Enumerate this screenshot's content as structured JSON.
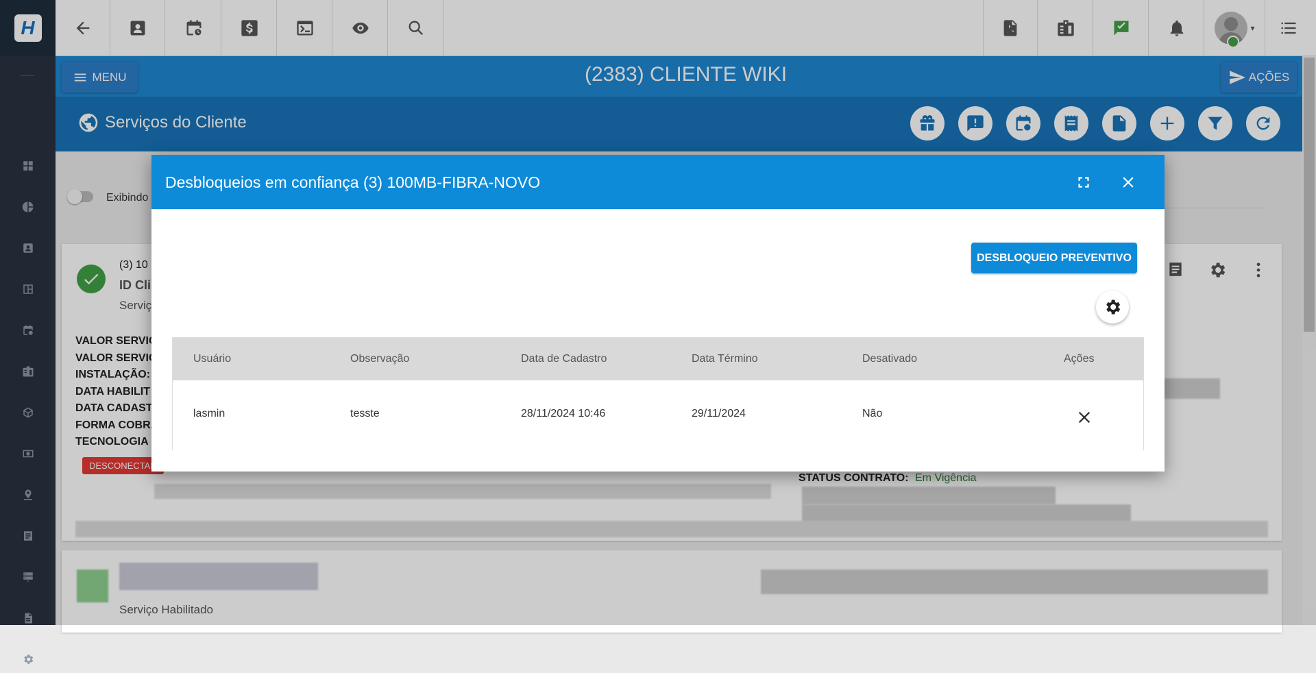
{
  "header": {
    "menu_label": "MENU",
    "client_title": "(2383) CLIENTE WIKI",
    "actions_label": "AÇÕES",
    "section_title": "Serviços do Cliente"
  },
  "page": {
    "toggle_label": "Exibindo",
    "service_code": "(3) 10",
    "id_label": "ID Cli",
    "service_sub": "Serviç",
    "fields": [
      "VALOR SERVIC",
      "VALOR SERVIC",
      "INSTALAÇÃO:",
      "DATA HABILIT",
      "DATA CADAST",
      "FORMA COBRA",
      "TECNOLOGIA"
    ],
    "status_badge": "DESCONECTAD",
    "status_contract_label": "STATUS CONTRATO:",
    "status_contract_value": "Em Vigência",
    "second_service_status": "Serviço Habilitado"
  },
  "modal": {
    "title": "Desbloqueios em confiança (3) 100MB-FIBRA-NOVO",
    "preventive_button": "DESBLOQUEIO PREVENTIVO",
    "columns": [
      "Usuário",
      "Observação",
      "Data de Cadastro",
      "Data Término",
      "Desativado",
      "Ações"
    ],
    "rows": [
      {
        "usuario": "lasmin",
        "observacao": "tesste",
        "data_cadastro": "28/11/2024 10:46",
        "data_termino": "29/11/2024",
        "desativado": "Não"
      }
    ]
  },
  "colors": {
    "header_blue": "#1e88d2",
    "subheader_blue": "#1874ba",
    "modal_blue": "#0d8bd9",
    "sidebar": "#2b3240",
    "badge_red": "#e53935",
    "ok_green": "#43a047"
  }
}
